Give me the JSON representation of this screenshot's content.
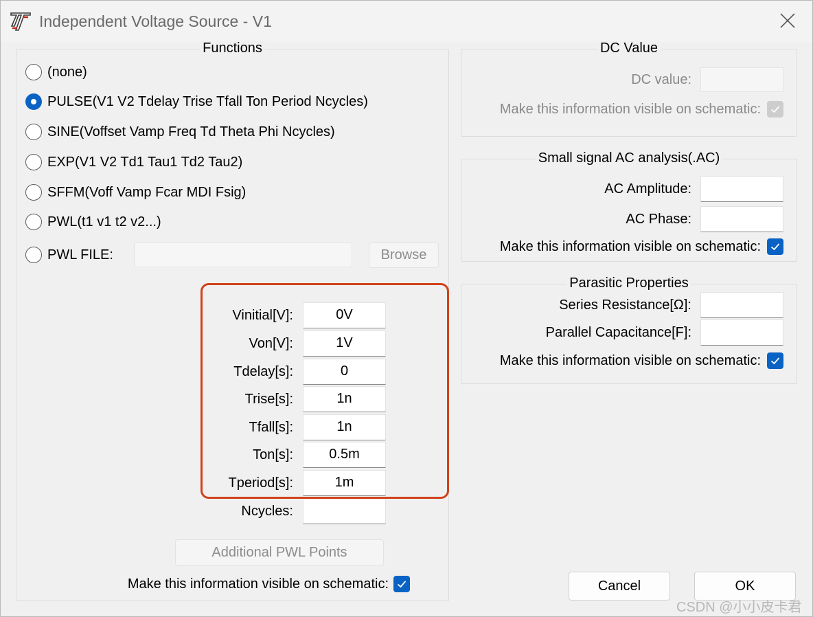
{
  "window": {
    "title": "Independent Voltage Source - V1"
  },
  "functions": {
    "title": "Functions",
    "options": [
      {
        "label": "(none)",
        "checked": false
      },
      {
        "label": "PULSE(V1 V2 Tdelay Trise Tfall Ton Period Ncycles)",
        "checked": true
      },
      {
        "label": "SINE(Voffset Vamp Freq Td Theta Phi Ncycles)",
        "checked": false
      },
      {
        "label": "EXP(V1 V2 Td1 Tau1 Td2 Tau2)",
        "checked": false
      },
      {
        "label": "SFFM(Voff Vamp Fcar MDI Fsig)",
        "checked": false
      },
      {
        "label": "PWL(t1 v1 t2 v2...)",
        "checked": false
      },
      {
        "label": "PWL FILE:",
        "checked": false
      }
    ],
    "pwl_file_value": "",
    "browse_label": "Browse",
    "params": [
      {
        "label": "Vinitial[V]:",
        "value": "0V"
      },
      {
        "label": "Von[V]:",
        "value": "1V"
      },
      {
        "label": "Tdelay[s]:",
        "value": "0"
      },
      {
        "label": "Trise[s]:",
        "value": "1n"
      },
      {
        "label": "Tfall[s]:",
        "value": "1n"
      },
      {
        "label": "Ton[s]:",
        "value": "0.5m"
      },
      {
        "label": "Tperiod[s]:",
        "value": "1m"
      },
      {
        "label": "Ncycles:",
        "value": ""
      }
    ],
    "additional_pwl_label": "Additional PWL Points",
    "visible_label": "Make this information visible on schematic:",
    "visible_checked": true
  },
  "dc": {
    "title": "DC Value",
    "value_label": "DC value:",
    "value": "",
    "visible_label": "Make this information visible on schematic:",
    "visible_checked": true
  },
  "ac": {
    "title": "Small signal AC analysis(.AC)",
    "amp_label": "AC Amplitude:",
    "amp_value": "",
    "phase_label": "AC Phase:",
    "phase_value": "",
    "visible_label": "Make this information visible on schematic:",
    "visible_checked": true
  },
  "parasitic": {
    "title": "Parasitic Properties",
    "series_label": "Series Resistance[Ω]:",
    "series_value": "",
    "parallel_label": "Parallel Capacitance[F]:",
    "parallel_value": "",
    "visible_label": "Make this information visible on schematic:",
    "visible_checked": true
  },
  "buttons": {
    "cancel": "Cancel",
    "ok": "OK"
  },
  "watermark": "CSDN @小小皮卡君",
  "colors": {
    "accent": "#0a63c4",
    "highlight": "#d0421b"
  }
}
